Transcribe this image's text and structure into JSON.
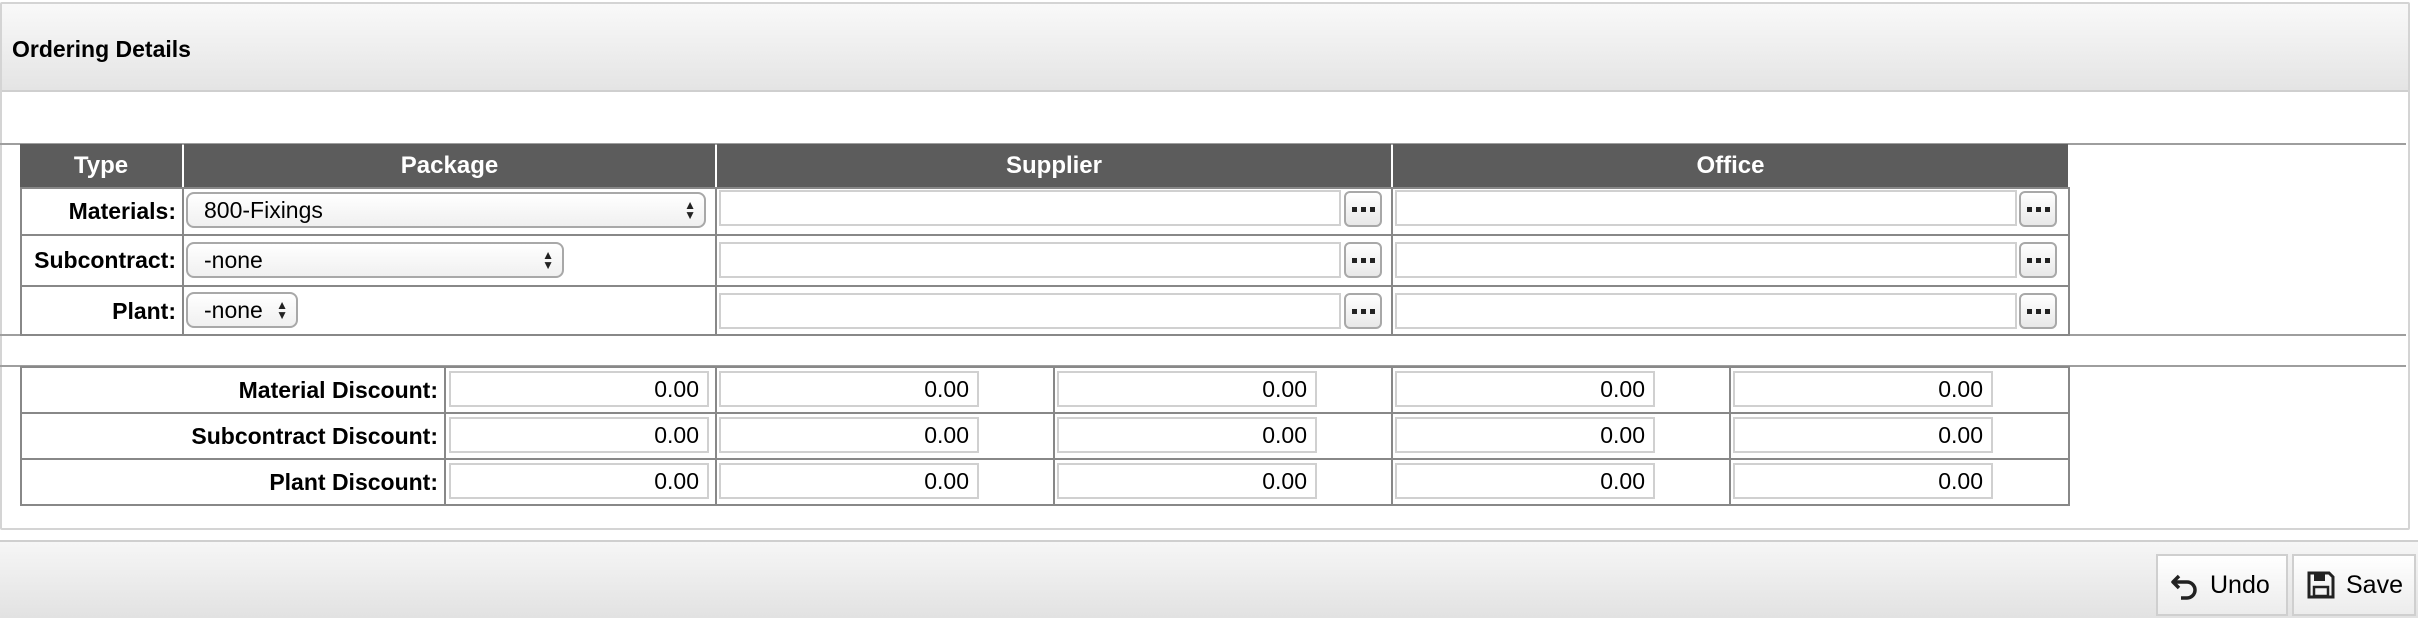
{
  "panel": {
    "title": "Ordering Details"
  },
  "table": {
    "headers": {
      "type": "Type",
      "package": "Package",
      "supplier": "Supplier",
      "office": "Office"
    },
    "rows": [
      {
        "label": "Materials:",
        "package": "800-Fixings",
        "supplier": "",
        "office": ""
      },
      {
        "label": "Subcontract:",
        "package": "-none",
        "supplier": "",
        "office": ""
      },
      {
        "label": "Plant:",
        "package": "-none",
        "supplier": "",
        "office": ""
      }
    ]
  },
  "discounts": [
    {
      "label": "Material Discount:",
      "values": [
        "0.00",
        "0.00",
        "0.00",
        "0.00",
        "0.00"
      ]
    },
    {
      "label": "Subcontract Discount:",
      "values": [
        "0.00",
        "0.00",
        "0.00",
        "0.00",
        "0.00"
      ]
    },
    {
      "label": "Plant Discount:",
      "values": [
        "0.00",
        "0.00",
        "0.00",
        "0.00",
        "0.00"
      ]
    }
  ],
  "footer": {
    "undo_label": "Undo",
    "save_label": "Save"
  },
  "icons": {
    "lookup": "ellipsis-icon",
    "select": "updown-arrows-icon",
    "undo": "undo-icon",
    "save": "save-icon"
  },
  "colors": {
    "header_bg": "#5c5c5c",
    "header_text": "#ffffff"
  }
}
